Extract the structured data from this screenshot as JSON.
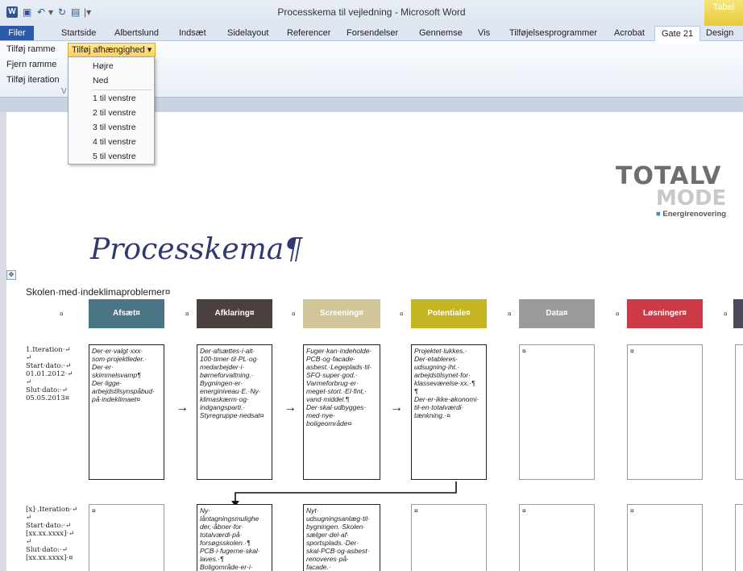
{
  "window": {
    "title": "Processkema til vejledning - Microsoft Word",
    "app_icon": "W",
    "context_tab": "Tabel"
  },
  "ribbon_tabs": [
    "Filer",
    "Startside",
    "Albertslund",
    "Indsæt",
    "Sidelayout",
    "Referencer",
    "Forsendelser",
    "Gennemse",
    "Vis",
    "Tilføjelsesprogrammer",
    "Acrobat",
    "Gate 21",
    "Design"
  ],
  "ribbon": {
    "add_frame": "Tilføj ramme",
    "remove_frame": "Fjern ramme",
    "add_iteration": "Tilføj iteration",
    "group_label": "V",
    "dropdown_label": "Tilføj afhængighed ▾"
  },
  "menu_items": [
    "Højre",
    "Ned",
    "1 til venstre",
    "2 til venstre",
    "3 til venstre",
    "4 til venstre",
    "5 til venstre"
  ],
  "document": {
    "logo_line1": "TOTALV",
    "logo_line2": "MODE",
    "logo_tag": "Energirenovering",
    "title": "Processkema¶",
    "subtitle": "Skolen·med·indeklimaproblemer¤",
    "columns": [
      {
        "label": "Afsæt¤",
        "color": "#4a7585"
      },
      {
        "label": "Afklaring¤",
        "color": "#4a403d"
      },
      {
        "label": "Screening¤",
        "color": "#d1c59a"
      },
      {
        "label": "Potentiale¤",
        "color": "#c5b522"
      },
      {
        "label": "Data¤",
        "color": "#9a9a9a"
      },
      {
        "label": "Løsninger¤",
        "color": "#cd3a46"
      }
    ],
    "row1_label": "1.Iteration·↵\n↵\nStart·dato:·↵\n01.01.2012·↵\n↵\nSlut·dato:·↵\n05.05.2013¤",
    "row1_cells": [
      "Der·er·valgt·xxx·\nsom·projektleder.·\nDer·er·\nskimmelsvamp¶\nDer·ligge·\narbejdstilsynspåbud·\npå·indeklimaet¤",
      "Der·afsættes·i·alt·\n100·timer·til·PL·og·\nmedarbejder·i·\nbørneforvaltning.·\nBygningen·er·\nenerginiveau·E.·Ny·\nklimaskærm·og·\nindgangsparti.·\nStyregruppe·nedsat¤",
      "Fuger·kan·indeholde·\nPCB·og·facade·\nasbest.·Legeplads·til·\nSFO·super·god.·\nVarmeforbrug·er·\nmeget·stort.·El·fint,·\nvand·middel.¶\nDer·skal·udbygges·\nmed·nye·\nboligeområde¤",
      "Projektet·lukkes.·\nDer·etableres·\nudsugning·iht.·\narbejdstilsynet·for·\nklasseværelse·xx.·¶\n¶\nDer·er·ikke·økonomi·\ntil·en·totalværdi·\ntænkning.·¤",
      "¤",
      "¤"
    ],
    "row2_label": "[x]·.Iteration·↵\n↵\nStart·dato:·↵\n[xx.xx.xxxx]·↵\n↵\nSlut·dato:·↵\n[xx.xx.xxxx]·¤",
    "row2_cells": [
      "¤",
      "Ny·\nlåntagningsmulighe\nder,·åbner·for·\ntotalværdi·på·\nforsøgsskolen.·¶\nPCB·i·fugerne·skal·\nlaves.·¶\nBoligområde·er·i·\nudførelses·fasen.·¶",
      "Nyt·\nudsugningsanlæg·til·\nbygningen.·Skolen·\nsælger·del·af·\nsportsplads.·Der·\nskal·PCB·og·asbest·\nrenoveres·på·\nfacade.·\nEftersidenen·¤Ny·",
      "¤",
      "¤",
      "¤"
    ],
    "cell_marker": "¤"
  }
}
